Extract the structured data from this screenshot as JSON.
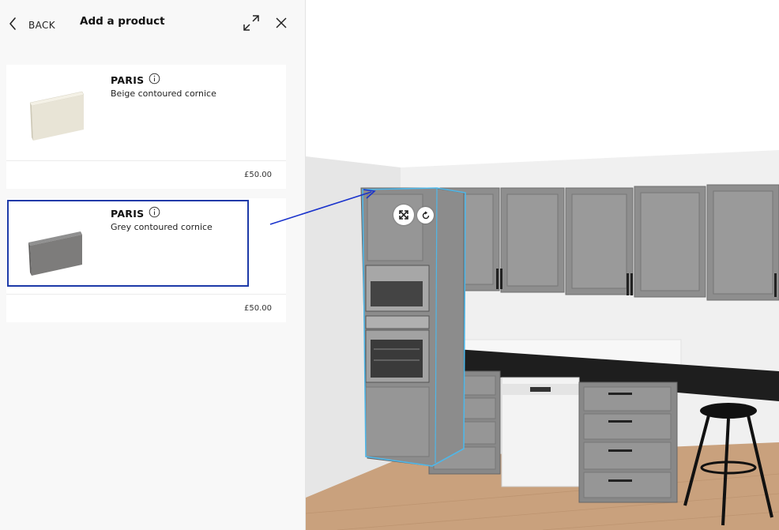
{
  "header": {
    "back_label": "BACK",
    "title": "Add a product"
  },
  "products": [
    {
      "brand": "PARIS",
      "description": "Beige contoured cornice",
      "price": "£50.00",
      "color": "#e8e4d6"
    },
    {
      "brand": "PARIS",
      "description": "Grey contoured cornice",
      "price": "£50.00",
      "color": "#7d7c7b"
    }
  ],
  "scene": {
    "selection_color": "#4fb7e8",
    "cabinet_color": "#8a8a8a",
    "countertop_color": "#1e1e1e",
    "floor_color": "#c9a17d",
    "annotation_arrow_color": "#1a33cc"
  },
  "icons": {
    "back": "chevron-left-icon",
    "expand": "expand-arrows-icon",
    "close": "close-icon",
    "info": "info-icon",
    "resize": "resize-icon",
    "rotate": "rotate-icon"
  }
}
